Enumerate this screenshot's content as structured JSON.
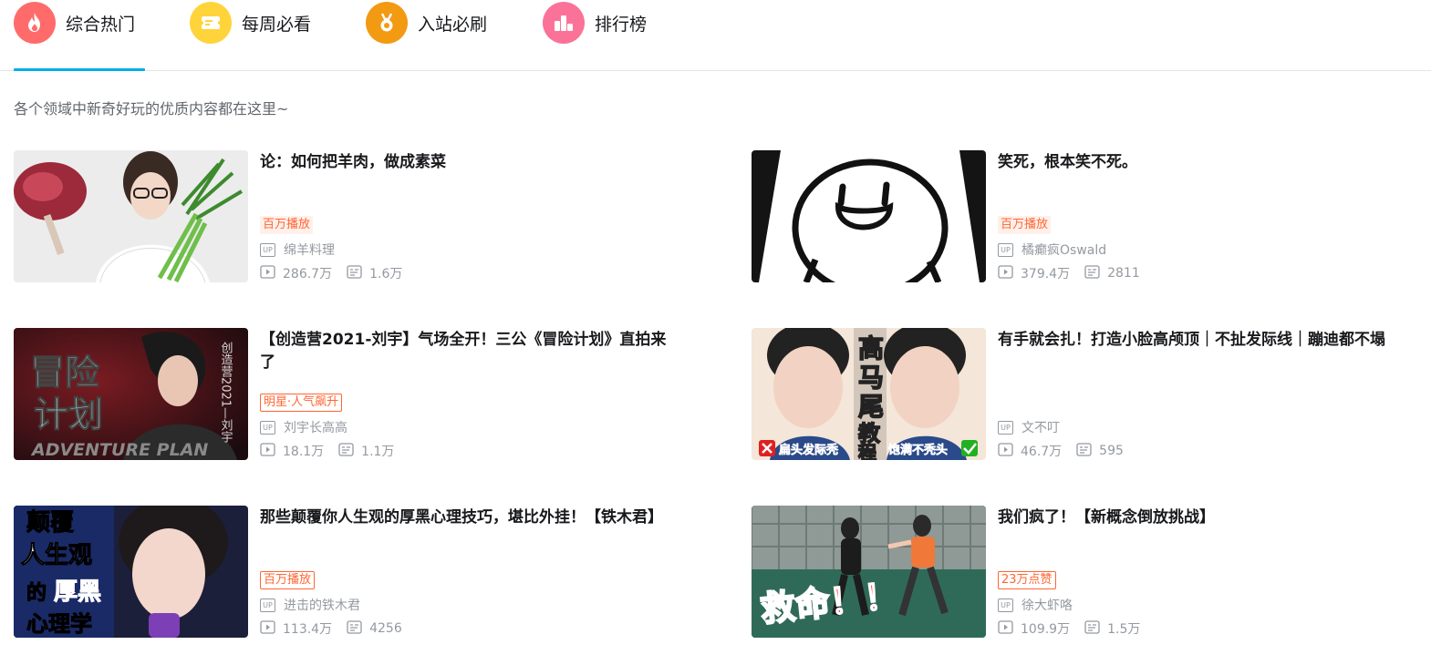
{
  "tabs": [
    {
      "label": "综合热门",
      "icon": "fire-icon",
      "color": "#ff6666",
      "active": true
    },
    {
      "label": "每周必看",
      "icon": "ticket-icon",
      "color": "#ffd633",
      "active": false
    },
    {
      "label": "入站必刷",
      "icon": "medal-icon",
      "color": "#fa9900",
      "active": false
    },
    {
      "label": "排行榜",
      "icon": "podium-icon",
      "color": "#ff7199",
      "active": false
    }
  ],
  "description": "各个领域中新奇好玩的优质内容都在这里~",
  "up_icon_text": "UP",
  "videos": [
    {
      "title": "论：如何把羊肉，做成素菜",
      "badge": "百万播放",
      "badge_style": "fill",
      "up": "绵羊料理",
      "plays": "286.7万",
      "danmaku": "1.6万",
      "thumb_text": ""
    },
    {
      "title": "笑死，根本笑不死。",
      "badge": "百万播放",
      "badge_style": "fill",
      "up": "橘癫疯Oswald",
      "plays": "379.4万",
      "danmaku": "2811",
      "thumb_text": ""
    },
    {
      "title": "【创造营2021-刘宇】气场全开！三公《冒险计划》直拍来了",
      "badge": "明星·人气飙升",
      "badge_style": "outline",
      "up": "刘宇长高高",
      "plays": "18.1万",
      "danmaku": "1.1万",
      "thumb_text": "冒险计划"
    },
    {
      "title": "有手就会扎！打造小脸高颅顶｜不扯发际线｜蹦迪都不塌",
      "badge": "",
      "badge_style": "none",
      "up": "文不叮",
      "plays": "46.7万",
      "danmaku": "595",
      "thumb_text": "高马尾教程"
    },
    {
      "title": "那些颠覆你人生观的厚黑心理技巧，堪比外挂！【铁木君】",
      "badge": "百万播放",
      "badge_style": "outline",
      "up": "进击的铁木君",
      "plays": "113.4万",
      "danmaku": "4256",
      "thumb_text": "颠覆"
    },
    {
      "title": "我们疯了！【新概念倒放挑战】",
      "badge": "23万点赞",
      "badge_style": "outline",
      "up": "徐大虾咯",
      "plays": "109.9万",
      "danmaku": "1.5万",
      "thumb_text": "救命！！"
    }
  ],
  "colors": {
    "accent": "#00aeec",
    "badge": "#ff6633",
    "meta": "#9499a0"
  }
}
